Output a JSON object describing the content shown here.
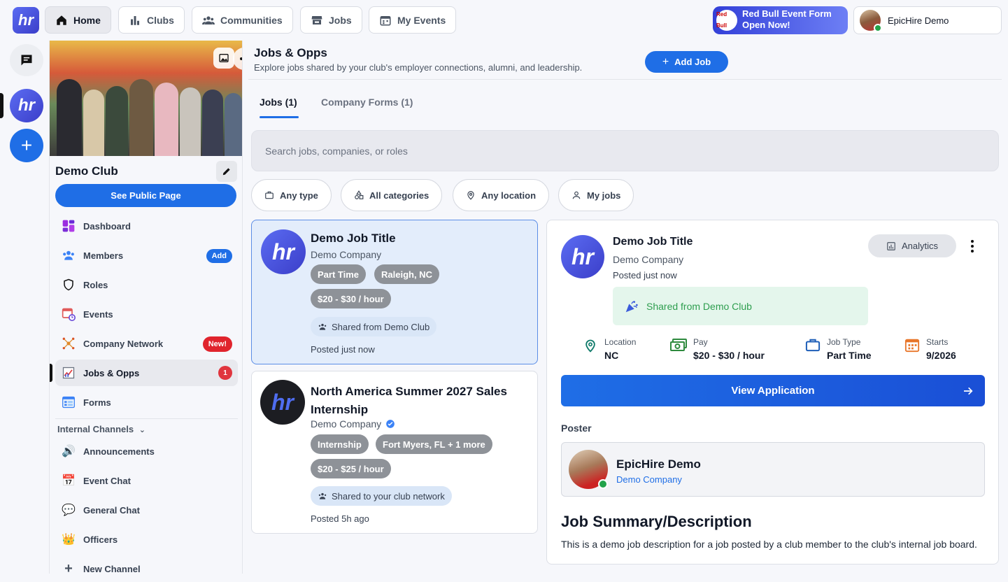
{
  "nav": {
    "items": [
      {
        "label": "Home",
        "icon": "home-icon"
      },
      {
        "label": "Clubs",
        "icon": "bar-chart-icon"
      },
      {
        "label": "Communities",
        "icon": "people-icon"
      },
      {
        "label": "Jobs",
        "icon": "store-icon"
      },
      {
        "label": "My Events",
        "icon": "calendar-icon"
      }
    ],
    "promo_line1": "Red Bull Event Form",
    "promo_line2": "Open Now!",
    "promo_badge": "Red Bull",
    "user_name": "EpicHire Demo"
  },
  "club": {
    "name": "Demo Club",
    "public_button": "See Public Page",
    "menu": [
      {
        "label": "Dashboard"
      },
      {
        "label": "Members",
        "pill": "Add"
      },
      {
        "label": "Roles"
      },
      {
        "label": "Events"
      },
      {
        "label": "Company Network",
        "pill": "New!"
      },
      {
        "label": "Jobs & Opps",
        "pill": "1"
      },
      {
        "label": "Forms"
      }
    ],
    "channels_header": "Internal Channels",
    "channels": [
      {
        "label": "Announcements",
        "icon": "🔊"
      },
      {
        "label": "Event Chat",
        "icon": "📅"
      },
      {
        "label": "General Chat",
        "icon": "💬"
      },
      {
        "label": "Officers",
        "icon": "👑"
      },
      {
        "label": "New Channel",
        "icon": "+"
      }
    ]
  },
  "page": {
    "title": "Jobs & Opps",
    "subtitle": "Explore jobs shared by your club's employer connections, alumni, and leadership.",
    "add_button": "Add Job",
    "tabs": [
      "Jobs (1)",
      "Company Forms (1)"
    ],
    "search_placeholder": "Search jobs, companies, or roles",
    "filters": [
      "Any type",
      "All categories",
      "Any location",
      "My jobs"
    ]
  },
  "jobs": [
    {
      "title": "Demo Job Title",
      "company": "Demo Company",
      "tags": [
        "Part Time",
        "Raleigh, NC",
        "$20 - $30 / hour"
      ],
      "share": "Shared from Demo Club",
      "posted": "Posted just now"
    },
    {
      "title": "North America Summer 2027 Sales Internship",
      "company": "Demo Company",
      "tags": [
        "Internship",
        "Fort Myers, FL + 1 more",
        "$20 - $25 / hour"
      ],
      "share": "Shared to your club network",
      "posted": "Posted 5h ago"
    }
  ],
  "detail": {
    "title": "Demo Job Title",
    "company": "Demo Company",
    "posted": "Posted just now",
    "analytics": "Analytics",
    "shared_banner": "Shared from Demo Club",
    "stats": [
      {
        "label": "Location",
        "value": "NC"
      },
      {
        "label": "Pay",
        "value": "$20 - $30 / hour"
      },
      {
        "label": "Job Type",
        "value": "Part Time"
      },
      {
        "label": "Starts",
        "value": "9/2026"
      }
    ],
    "view_button": "View Application",
    "poster_label": "Poster",
    "poster_name": "EpicHire Demo",
    "poster_company": "Demo Company",
    "summary_title": "Job Summary/Description",
    "summary_text": "This is a demo job description for a job posted by a club member to the club's internal job board."
  },
  "colors": {
    "accent": "#1f6ee6",
    "selected_card": "#e3edfb",
    "tag_gray": "#8e9298",
    "success_green": "#2e9e4f"
  }
}
